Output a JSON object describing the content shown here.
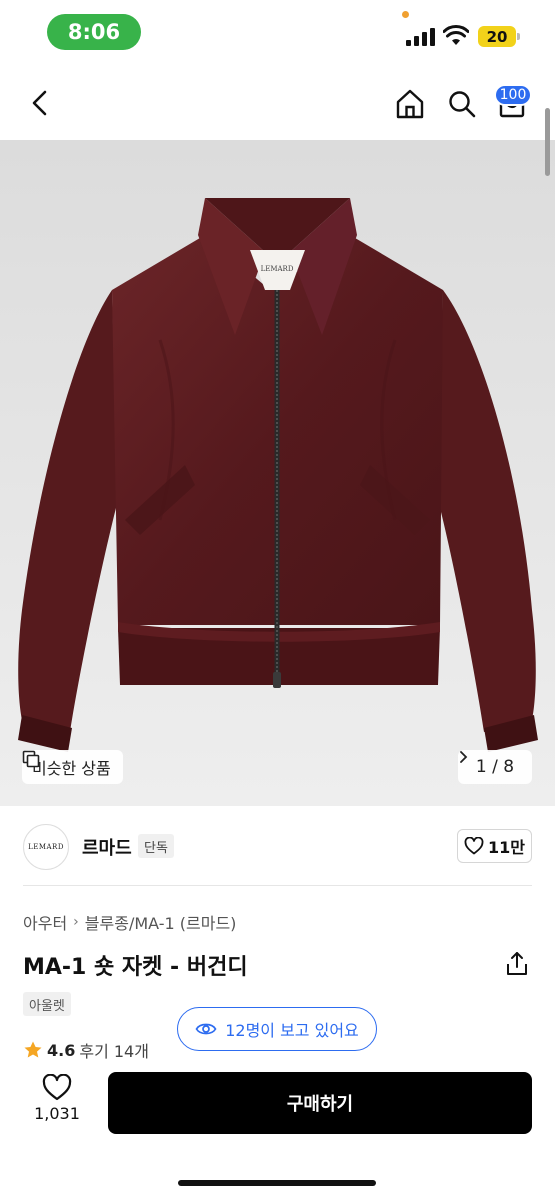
{
  "status_bar": {
    "time": "8:06",
    "battery": "20",
    "colors": {
      "time_pill": "#38b34a",
      "battery": "#f2d21a"
    }
  },
  "nav": {
    "cart_badge": "100",
    "icons": [
      "chevron-left-icon",
      "home-icon",
      "search-icon",
      "cart-icon"
    ],
    "badge_color": "#2d6cf0"
  },
  "gallery": {
    "similar_label": "비슷한 상품",
    "page_counter": "1 / 8",
    "jacket_label": "LEMARD",
    "jacket_color": "#5a1f22"
  },
  "seller": {
    "logo_text": "LEMARD",
    "name": "르마드",
    "tag": "단독",
    "likes": "11만"
  },
  "product": {
    "breadcrumb": [
      "아우터",
      "블루종/MA-1 (르마드)"
    ],
    "title": "MA-1 숏 자켓 - 버건디",
    "tag": "아울렛",
    "rating": "4.6",
    "reviews": "후기 14개",
    "viewers": "12명이 보고 있어요",
    "accent_color": "#2d6cf0"
  },
  "bottom_bar": {
    "wish_count": "1,031",
    "buy_label": "구매하기"
  }
}
